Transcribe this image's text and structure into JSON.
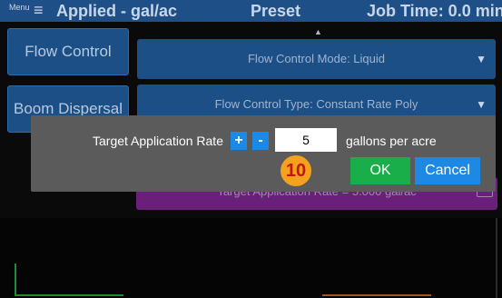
{
  "topbar": {
    "menu_label": "Menu",
    "title": "Applied - gal/ac",
    "preset": "Preset",
    "job_time": "Job Time: 0.0 min"
  },
  "sidebar": {
    "flow_control": "Flow Control",
    "boom_dispersal": "Boom Dispersal"
  },
  "dropdowns": {
    "mode": "Flow Control Mode: Liquid",
    "type": "Flow Control Type: Constant Rate Poly"
  },
  "background_row": {
    "text": "Target Application Rate = 5.000 gal/ac"
  },
  "dialog": {
    "label": "Target Application Rate",
    "plus": "+",
    "minus": "-",
    "value": "5",
    "units": "gallons per acre",
    "step_badge": "10",
    "ok": "OK",
    "cancel": "Cancel"
  },
  "colors": {
    "accent_blue": "#1e88e5",
    "ok_green": "#1aae4a",
    "badge_orange": "#f4a21e",
    "badge_text_red": "#c2160f",
    "panel_blue": "#1b4f86",
    "purple_strip": "#6a1f7a"
  }
}
